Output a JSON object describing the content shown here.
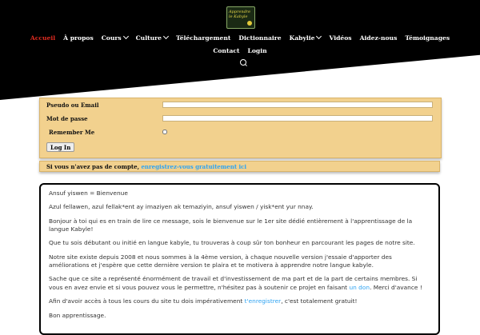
{
  "header": {
    "logo_text_line1": "Apprendre",
    "logo_text_line2": "le Kabyle"
  },
  "nav": {
    "row1": [
      {
        "label": "Accueil",
        "active": true,
        "dropdown": false
      },
      {
        "label": "À propos",
        "active": false,
        "dropdown": false
      },
      {
        "label": "Cours",
        "active": false,
        "dropdown": true
      },
      {
        "label": "Culture",
        "active": false,
        "dropdown": true
      },
      {
        "label": "Téléchargement",
        "active": false,
        "dropdown": false
      },
      {
        "label": "Dictionnaire",
        "active": false,
        "dropdown": false
      },
      {
        "label": "Kabylie",
        "active": false,
        "dropdown": true
      },
      {
        "label": "Vidéos",
        "active": false,
        "dropdown": false
      },
      {
        "label": "Aidez-nous",
        "active": false,
        "dropdown": false
      },
      {
        "label": "Témoignages",
        "active": false,
        "dropdown": false
      }
    ],
    "row2": [
      {
        "label": "Contact",
        "active": false,
        "dropdown": false
      },
      {
        "label": "Login",
        "active": false,
        "dropdown": false
      }
    ],
    "search_icon": "search-icon",
    "active_color": "#e02b20"
  },
  "login": {
    "username_label": "Pseudo ou Email",
    "username_value": "",
    "password_label": "Mot de passe",
    "password_value": "",
    "remember_label": "Remember Me",
    "submit_label": "Log In",
    "panel_color": "#f2d18e"
  },
  "register": {
    "prefix": "Si vous n'avez pas de compte, ",
    "link": "enregistrez-vous gratuitement ici",
    "link_color": "#2ea3f2"
  },
  "welcome": {
    "p1": "Ansuf yiswen = Bienvenue",
    "p2": "Azul fellawen, azul fellak*ent ay imaziyen ak temaziyin, ansuf yiswen / yisk*ent yur nnay.",
    "p3": "Bonjour à toi qui es en train de lire ce message, sois le bienvenue sur le 1er site dédié entièrement à l'apprentissage de la langue Kabyle!",
    "p4": "Que tu sois débutant ou initié en langue kabyle, tu trouveras à coup sûr ton bonheur en parcourant les pages de notre site.",
    "p5": "Notre site existe depuis 2008 et nous sommes à la 4ème version, à chaque nouvelle version j'essaie d'apporter des améliorations et j'espère que cette dernière version te plaira et te motivera à apprendre notre langue kabyle.",
    "p6_before": "Sache que ce site a représenté énormément de travail et d'investissement de ma part et de la part de certains membres. Si vous en avez envie et si vous pouvez vous le permettre, n'hésitez pas à soutenir ce projet en faisant ",
    "p6_link": "un don",
    "p6_after": ". Merci d'avance !",
    "p7_before": "Afin d'avoir accès à tous les cours du site tu dois impérativement ",
    "p7_link": "t'enregistrer",
    "p7_after": ", c'est totalement gratuit!",
    "p8": "Bon apprentissage."
  }
}
